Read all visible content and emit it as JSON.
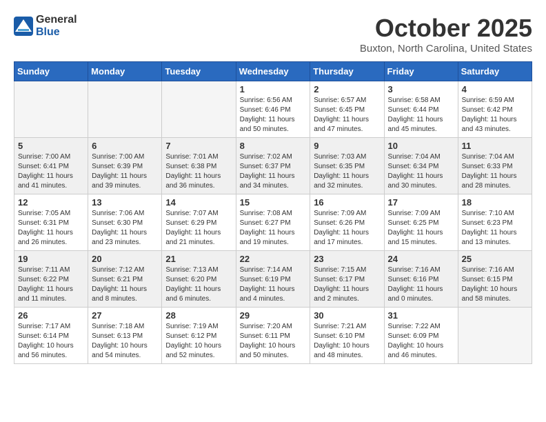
{
  "header": {
    "logo_general": "General",
    "logo_blue": "Blue",
    "month": "October 2025",
    "location": "Buxton, North Carolina, United States"
  },
  "weekdays": [
    "Sunday",
    "Monday",
    "Tuesday",
    "Wednesday",
    "Thursday",
    "Friday",
    "Saturday"
  ],
  "weeks": [
    [
      {
        "day": "",
        "info": ""
      },
      {
        "day": "",
        "info": ""
      },
      {
        "day": "",
        "info": ""
      },
      {
        "day": "1",
        "info": "Sunrise: 6:56 AM\nSunset: 6:46 PM\nDaylight: 11 hours\nand 50 minutes."
      },
      {
        "day": "2",
        "info": "Sunrise: 6:57 AM\nSunset: 6:45 PM\nDaylight: 11 hours\nand 47 minutes."
      },
      {
        "day": "3",
        "info": "Sunrise: 6:58 AM\nSunset: 6:44 PM\nDaylight: 11 hours\nand 45 minutes."
      },
      {
        "day": "4",
        "info": "Sunrise: 6:59 AM\nSunset: 6:42 PM\nDaylight: 11 hours\nand 43 minutes."
      }
    ],
    [
      {
        "day": "5",
        "info": "Sunrise: 7:00 AM\nSunset: 6:41 PM\nDaylight: 11 hours\nand 41 minutes."
      },
      {
        "day": "6",
        "info": "Sunrise: 7:00 AM\nSunset: 6:39 PM\nDaylight: 11 hours\nand 39 minutes."
      },
      {
        "day": "7",
        "info": "Sunrise: 7:01 AM\nSunset: 6:38 PM\nDaylight: 11 hours\nand 36 minutes."
      },
      {
        "day": "8",
        "info": "Sunrise: 7:02 AM\nSunset: 6:37 PM\nDaylight: 11 hours\nand 34 minutes."
      },
      {
        "day": "9",
        "info": "Sunrise: 7:03 AM\nSunset: 6:35 PM\nDaylight: 11 hours\nand 32 minutes."
      },
      {
        "day": "10",
        "info": "Sunrise: 7:04 AM\nSunset: 6:34 PM\nDaylight: 11 hours\nand 30 minutes."
      },
      {
        "day": "11",
        "info": "Sunrise: 7:04 AM\nSunset: 6:33 PM\nDaylight: 11 hours\nand 28 minutes."
      }
    ],
    [
      {
        "day": "12",
        "info": "Sunrise: 7:05 AM\nSunset: 6:31 PM\nDaylight: 11 hours\nand 26 minutes."
      },
      {
        "day": "13",
        "info": "Sunrise: 7:06 AM\nSunset: 6:30 PM\nDaylight: 11 hours\nand 23 minutes."
      },
      {
        "day": "14",
        "info": "Sunrise: 7:07 AM\nSunset: 6:29 PM\nDaylight: 11 hours\nand 21 minutes."
      },
      {
        "day": "15",
        "info": "Sunrise: 7:08 AM\nSunset: 6:27 PM\nDaylight: 11 hours\nand 19 minutes."
      },
      {
        "day": "16",
        "info": "Sunrise: 7:09 AM\nSunset: 6:26 PM\nDaylight: 11 hours\nand 17 minutes."
      },
      {
        "day": "17",
        "info": "Sunrise: 7:09 AM\nSunset: 6:25 PM\nDaylight: 11 hours\nand 15 minutes."
      },
      {
        "day": "18",
        "info": "Sunrise: 7:10 AM\nSunset: 6:23 PM\nDaylight: 11 hours\nand 13 minutes."
      }
    ],
    [
      {
        "day": "19",
        "info": "Sunrise: 7:11 AM\nSunset: 6:22 PM\nDaylight: 11 hours\nand 11 minutes."
      },
      {
        "day": "20",
        "info": "Sunrise: 7:12 AM\nSunset: 6:21 PM\nDaylight: 11 hours\nand 8 minutes."
      },
      {
        "day": "21",
        "info": "Sunrise: 7:13 AM\nSunset: 6:20 PM\nDaylight: 11 hours\nand 6 minutes."
      },
      {
        "day": "22",
        "info": "Sunrise: 7:14 AM\nSunset: 6:19 PM\nDaylight: 11 hours\nand 4 minutes."
      },
      {
        "day": "23",
        "info": "Sunrise: 7:15 AM\nSunset: 6:17 PM\nDaylight: 11 hours\nand 2 minutes."
      },
      {
        "day": "24",
        "info": "Sunrise: 7:16 AM\nSunset: 6:16 PM\nDaylight: 11 hours\nand 0 minutes."
      },
      {
        "day": "25",
        "info": "Sunrise: 7:16 AM\nSunset: 6:15 PM\nDaylight: 10 hours\nand 58 minutes."
      }
    ],
    [
      {
        "day": "26",
        "info": "Sunrise: 7:17 AM\nSunset: 6:14 PM\nDaylight: 10 hours\nand 56 minutes."
      },
      {
        "day": "27",
        "info": "Sunrise: 7:18 AM\nSunset: 6:13 PM\nDaylight: 10 hours\nand 54 minutes."
      },
      {
        "day": "28",
        "info": "Sunrise: 7:19 AM\nSunset: 6:12 PM\nDaylight: 10 hours\nand 52 minutes."
      },
      {
        "day": "29",
        "info": "Sunrise: 7:20 AM\nSunset: 6:11 PM\nDaylight: 10 hours\nand 50 minutes."
      },
      {
        "day": "30",
        "info": "Sunrise: 7:21 AM\nSunset: 6:10 PM\nDaylight: 10 hours\nand 48 minutes."
      },
      {
        "day": "31",
        "info": "Sunrise: 7:22 AM\nSunset: 6:09 PM\nDaylight: 10 hours\nand 46 minutes."
      },
      {
        "day": "",
        "info": ""
      }
    ]
  ]
}
